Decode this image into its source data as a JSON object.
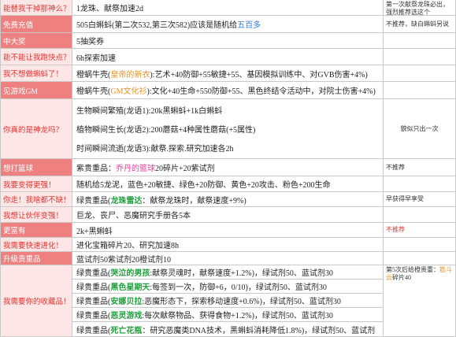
{
  "palette": {
    "text": "#1f1f1f",
    "note_text": "#333333",
    "grid": "#c9c9c9",
    "label_text": "#e3342f",
    "label_bg": "#fde6e6",
    "label_strong_bg": "#ee8080",
    "label_strong_text": "#ffffff",
    "note_alert": "#e3342f",
    "hl_blue": "#2d7fd8",
    "hl_orange": "#f0901c",
    "hl_green": "#1f9e3a",
    "hl_pink": "#e8409a"
  },
  "rows": [
    {
      "label": "能替我干掉那神么？",
      "reward": [
        "1龙珠、献祭加速2d"
      ],
      "note": [
        "第一次献祭龙珠必出，强烈推荐选这个"
      ]
    },
    {
      "label": "免费充值",
      "reward": [
        "505白蝌蚪(第二次532,第三次582)应该是随机给",
        "五百多"
      ],
      "note": [
        "不推荐，缺白蝌蚪另说"
      ]
    },
    {
      "label": "中大奖",
      "reward": [
        "5抽奖券"
      ]
    },
    {
      "label": "能不能让我跑快点？",
      "reward": [
        "6h探索加速"
      ]
    },
    {
      "label": "我不想做蝌蚪了！",
      "reward": [
        "橙蜗牛壳(",
        "皇帝的新衣",
        "):艺术+40防御+55敏捷+55、基因模拟训练中、对GVB伤害+4%)"
      ]
    },
    {
      "label": "见游戏GM",
      "reward": [
        "橙蜗牛壳(",
        "GM文化衫",
        "):文化+40生命+550防御+55、黑色终结令活动中，对院士伤害+4%)"
      ]
    },
    {
      "label": "你真的是神龙吗？",
      "reward_lines": [
        [
          "生物瞬间繁殖(龙语1):20k黑蝌蚪+1k白蝌蚪"
        ],
        [
          "植物瞬间生长(龙语2):200蘑菇+4种属性蘑菇(+5属性)"
        ],
        [
          "时间瞬间流逝(龙语3):献祭.探索.研究加速各2h"
        ]
      ],
      "note": [
        "貌似只出一次"
      ]
    },
    {
      "label": "想打篮球",
      "reward": [
        "紫贵重品：",
        "乔丹的篮球",
        "20碎片+20紫试剂"
      ],
      "note": [
        "不推荐"
      ]
    },
    {
      "label": "我要变得更强！",
      "reward": [
        "随机给5龙泥，蓝色+20敏捷、绿色+20防御、黄色+20攻击、粉色+200生命"
      ]
    },
    {
      "label": "你走！我啥都不缺！",
      "reward": [
        "绿贵重品(",
        "龙珠雷达",
        "：献祭龙珠时，献祭速度+9%)"
      ],
      "note": [
        "早获得早享受"
      ]
    },
    {
      "label": "我想让伙伴变强！",
      "reward": [
        "巨龙、丧尸、恶魔研究手册各5本"
      ]
    },
    {
      "label": "更富有",
      "reward": [
        "2k+黑蝌蚪"
      ],
      "note": [
        "不推荐"
      ]
    },
    {
      "label": "我需要快速进化！",
      "reward": [
        "进化宝箱碎片20、研究加速8h"
      ]
    },
    {
      "label": "升级贵重品",
      "reward": [
        "蓝试剂50紫试剂20橙试剂10"
      ]
    },
    {
      "label": "我需要你的收藏品！",
      "reward_lines": [
        [
          "绿贵重品(",
          "哭泣的男孩",
          ":献祭灵魂时，献祭速度+1.2%)，绿试剂50、蓝试剂30"
        ],
        [
          "绿贵重品(",
          "黑色星期天",
          ":每签到一次，防御+6，0/10)，绿试剂50、蓝试剂30"
        ],
        [
          "绿贵重品(",
          "安娜贝拉",
          ":恶魔形态下，探索移动速度+0.6%)，绿试剂50、蓝试剂30"
        ],
        [
          "绿贵重品(",
          "恶灵游戏",
          ":每次献祭物品、获得食物+1.2%)，绿试剂50、蓝试剂30"
        ],
        [
          "绿贵重品(",
          "死亡花瓶",
          "：研究恶魔类DNA技术，黑蝌蚪消耗降低1.8%)，绿试剂50、蓝试剂"
        ]
      ],
      "note": [
        "第5次后给橙贵重：",
        "筋斗云",
        "碎片40"
      ]
    }
  ]
}
